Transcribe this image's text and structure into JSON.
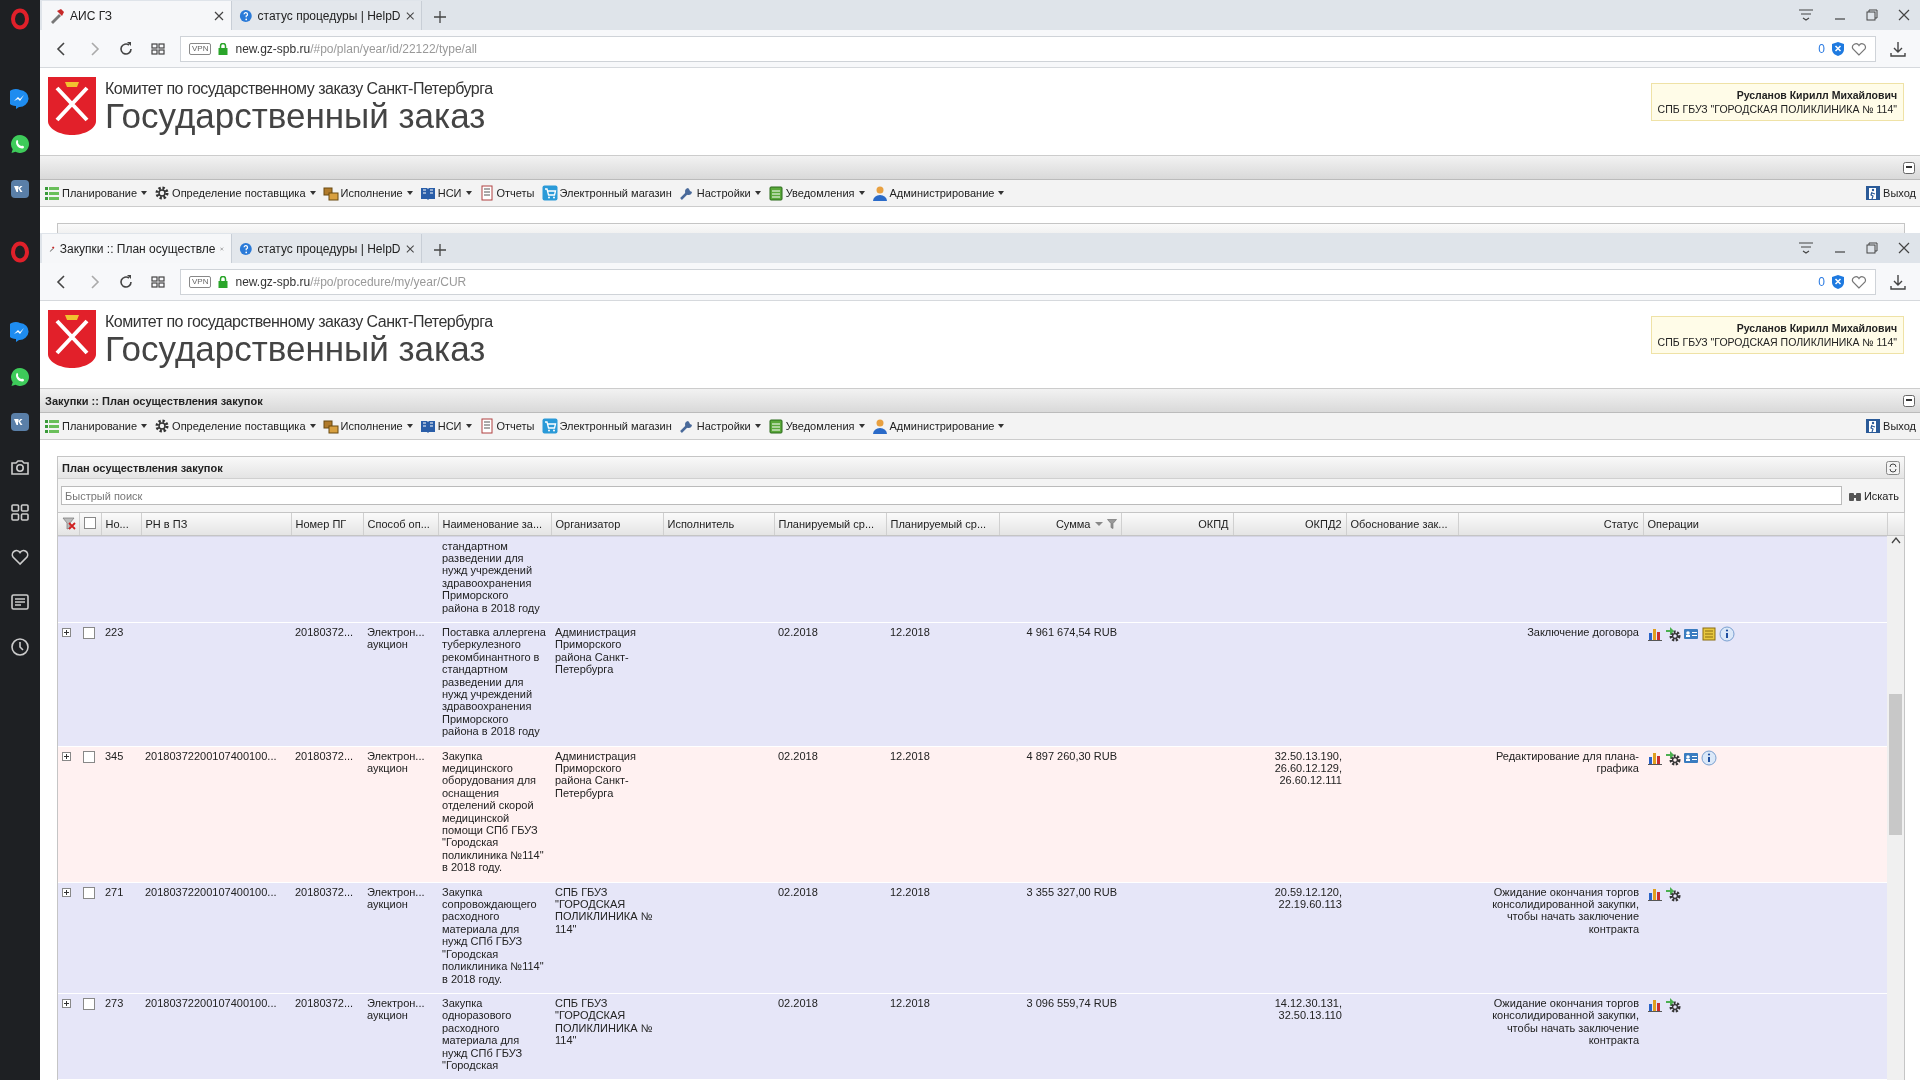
{
  "windows": [
    {
      "sidebar": [
        {
          "kind": "opera"
        },
        {
          "kind": "messenger"
        },
        {
          "kind": "whatsapp"
        },
        {
          "kind": "vk"
        }
      ],
      "tabs": [
        {
          "title": "АИС ГЗ",
          "kind": "site",
          "selected": true
        },
        {
          "title": "статус процедуры | HelpD",
          "kind": "help",
          "selected": false
        }
      ],
      "address": {
        "vpn": "VPN",
        "host": "new.gz-spb.ru",
        "path": "/#po/plan/year/id/22122/type/all",
        "blocked": "0"
      },
      "header": {
        "org": "Комитет по государственному заказу Санкт-Петербурга",
        "title": "Государственный заказ",
        "user_name": "Русланов Кирилл Михайлович",
        "user_org": "СПБ ГБУЗ \"ГОРОДСКАЯ ПОЛИКЛИНИКА № 114\""
      },
      "menu": [
        {
          "label": "Планирование",
          "kind": "planning",
          "dropdown": true
        },
        {
          "label": "Определение поставщика",
          "kind": "supplier",
          "dropdown": true
        },
        {
          "label": "Исполнение",
          "kind": "execution",
          "dropdown": true
        },
        {
          "label": "НСИ",
          "kind": "nsi",
          "dropdown": true
        },
        {
          "label": "Отчеты",
          "kind": "reports",
          "dropdown": false
        },
        {
          "label": "Электронный магазин",
          "kind": "shop",
          "dropdown": false
        },
        {
          "label": "Настройки",
          "kind": "settings",
          "dropdown": true
        },
        {
          "label": "Уведомления",
          "kind": "notifications",
          "dropdown": true
        },
        {
          "label": "Администрирование",
          "kind": "admin",
          "dropdown": true
        }
      ],
      "exit": "Выход"
    },
    {
      "sidebar": [
        {
          "kind": "opera"
        },
        {
          "kind": "messenger"
        },
        {
          "kind": "whatsapp"
        },
        {
          "kind": "vk"
        },
        {
          "kind": "camera"
        },
        {
          "kind": "apps"
        },
        {
          "kind": "heart"
        },
        {
          "kind": "news"
        },
        {
          "kind": "clock"
        }
      ],
      "tabs": [
        {
          "title": "Закупки :: План осуществле",
          "kind": "site",
          "selected": true
        },
        {
          "title": "статус процедуры | HelpD",
          "kind": "help",
          "selected": false
        }
      ],
      "address": {
        "vpn": "VPN",
        "host": "new.gz-spb.ru",
        "path": "/#po/procedure/my/year/CUR",
        "blocked": "0"
      },
      "header": {
        "org": "Комитет по государственному заказу Санкт-Петербурга",
        "title": "Государственный заказ",
        "user_name": "Русланов Кирилл Михайлович",
        "user_org": "СПБ ГБУЗ \"ГОРОДСКАЯ ПОЛИКЛИНИКА № 114\""
      },
      "page_title": "Закупки :: План осуществления закупок",
      "menu": [
        {
          "label": "Планирование",
          "kind": "planning",
          "dropdown": true
        },
        {
          "label": "Определение поставщика",
          "kind": "supplier",
          "dropdown": true
        },
        {
          "label": "Исполнение",
          "kind": "execution",
          "dropdown": true
        },
        {
          "label": "НСИ",
          "kind": "nsi",
          "dropdown": true
        },
        {
          "label": "Отчеты",
          "kind": "reports",
          "dropdown": false
        },
        {
          "label": "Электронный магазин",
          "kind": "shop",
          "dropdown": false
        },
        {
          "label": "Настройки",
          "kind": "settings",
          "dropdown": true
        },
        {
          "label": "Уведомления",
          "kind": "notifications",
          "dropdown": true
        },
        {
          "label": "Администрирование",
          "kind": "admin",
          "dropdown": true
        }
      ],
      "exit": "Выход",
      "grid": {
        "title": "План осуществления закупок",
        "search": {
          "placeholder": "Быстрый поиск",
          "button": "Искать"
        },
        "all_checked": false,
        "columns": [
          {
            "label": "Но...",
            "sorted": false,
            "filtered": false
          },
          {
            "label": "РН в ПЗ",
            "sorted": false,
            "filtered": false
          },
          {
            "label": "Номер ПГ",
            "sorted": false,
            "filtered": false
          },
          {
            "label": "Способ оп...",
            "sorted": false,
            "filtered": false
          },
          {
            "label": "Наименование за...",
            "sorted": false,
            "filtered": false
          },
          {
            "label": "Организатор",
            "sorted": false,
            "filtered": false
          },
          {
            "label": "Исполнитель",
            "sorted": false,
            "filtered": false
          },
          {
            "label": "Планируемый ср...",
            "sorted": false,
            "filtered": false
          },
          {
            "label": "Планируемый ср...",
            "sorted": false,
            "filtered": false
          },
          {
            "label": "Сумма",
            "sorted": true,
            "filtered": true
          },
          {
            "label": "ОКПД",
            "sorted": false,
            "filtered": false
          },
          {
            "label": "ОКПД2",
            "sorted": false,
            "filtered": false
          },
          {
            "label": "Обоснование зак...",
            "sorted": false,
            "filtered": false
          },
          {
            "label": "Статус",
            "sorted": false,
            "filtered": false
          },
          {
            "label": "Операции",
            "sorted": false,
            "filtered": false
          }
        ],
        "rows": [
          {
            "name": "стандартном разведении для нужд учреждений здравоохранения Приморского района в 2018 году",
            "highlighted": false
          },
          {
            "expanded": false,
            "checked": false,
            "highlighted": false,
            "number": "223",
            "pg_number": "20180372...",
            "method": "Электрон... аукцион",
            "name": "Поставка аллергена туберкулезного рекомбинантного в стандартном разведении для нужд учреждений здравоохранения Приморского района в 2018 году",
            "organizer": "Администрация Приморского района Санкт-Петербурга",
            "planned_start": "02.2018",
            "planned_end": "12.2018",
            "sum": "4 961 674,54 RUB",
            "status": "Заключение договора",
            "operations": [
              {
                "kind": "report"
              },
              {
                "kind": "settings"
              },
              {
                "kind": "card"
              },
              {
                "kind": "scroll"
              },
              {
                "kind": "info"
              }
            ]
          },
          {
            "expanded": false,
            "checked": false,
            "highlighted": true,
            "number": "345",
            "rn_pz": "20180372200107400100...",
            "pg_number": "20180372...",
            "method": "Электрон... аукцион",
            "name": "Закупка медицинского оборудования для оснащения отделений скорой медицинской помощи СПб ГБУЗ \"Городская поликлиника №114\" в 2018 году.",
            "organizer": "Администрация Приморского района Санкт-Петербурга",
            "planned_start": "02.2018",
            "planned_end": "12.2018",
            "sum": "4 897 260,30 RUB",
            "okpd2": "32.50.13.190, 26.60.12.129, 26.60.12.111",
            "status": "Редактирование для плана-графика",
            "operations": [
              {
                "kind": "report"
              },
              {
                "kind": "settings"
              },
              {
                "kind": "card"
              },
              {
                "kind": "info"
              }
            ]
          },
          {
            "expanded": false,
            "checked": false,
            "highlighted": false,
            "number": "271",
            "rn_pz": "20180372200107400100...",
            "pg_number": "20180372...",
            "method": "Электрон... аукцион",
            "name": "Закупка сопровождающего расходного материала для нужд СПб ГБУЗ \"Городская поликлиника №114\" в 2018 году.",
            "organizer": "СПБ ГБУЗ \"ГОРОДСКАЯ ПОЛИКЛИНИКА № 114\"",
            "planned_start": "02.2018",
            "planned_end": "12.2018",
            "sum": "3 355 327,00 RUB",
            "okpd2": "20.59.12.120, 22.19.60.113",
            "status": "Ожидание окончания торгов консолидированной закупки, чтобы начать заключение контракта",
            "operations": [
              {
                "kind": "report"
              },
              {
                "kind": "settings"
              }
            ]
          },
          {
            "expanded": false,
            "checked": false,
            "highlighted": false,
            "number": "273",
            "rn_pz": "20180372200107400100...",
            "pg_number": "20180372...",
            "method": "Электрон... аукцион",
            "name": "Закупка одноразового расходного материала для нужд СПб ГБУЗ \"Городская",
            "organizer": "СПБ ГБУЗ \"ГОРОДСКАЯ ПОЛИКЛИНИКА № 114\"",
            "planned_start": "02.2018",
            "planned_end": "12.2018",
            "sum": "3 096 559,74 RUB",
            "okpd2": "14.12.30.131, 32.50.13.110",
            "status": "Ожидание окончания торгов консолидированной закупки, чтобы начать заключение контракта",
            "operations": [
              {
                "kind": "report"
              },
              {
                "kind": "settings"
              }
            ]
          }
        ]
      }
    }
  ]
}
